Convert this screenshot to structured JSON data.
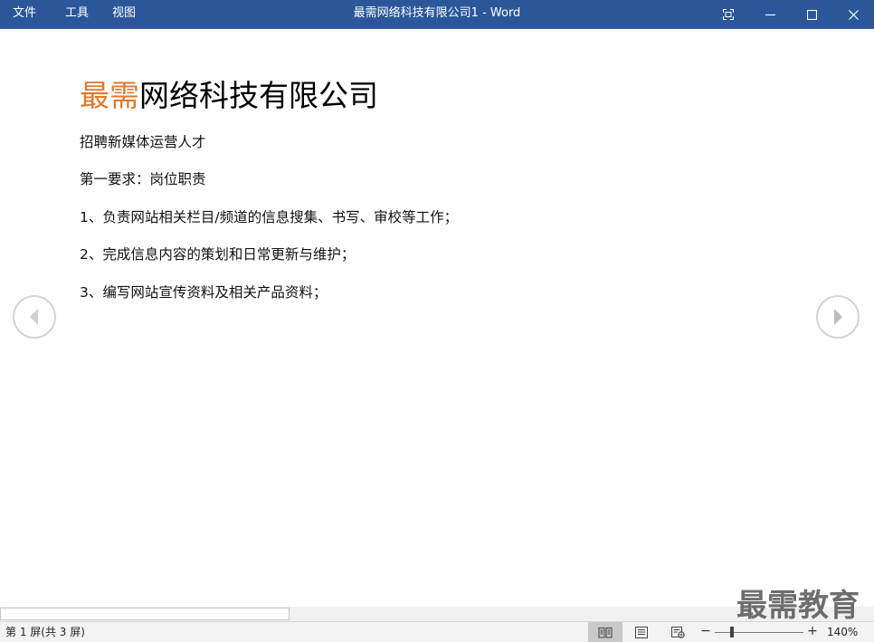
{
  "menu": {
    "file": "文件",
    "tools": "工具",
    "view": "视图"
  },
  "window": {
    "title": "最需网络科技有限公司1  -  Word",
    "title_bar_color": "#2b579a"
  },
  "document": {
    "heading_accent": "最需",
    "heading_rest": "网络科技有限公司",
    "heading_accent_color": "#e0782f",
    "paragraphs": [
      "招聘新媒体运营人才",
      "第一要求：岗位职责",
      "1、负责网站相关栏目/频道的信息搜集、书写、审校等工作；",
      "2、完成信息内容的策划和日常更新与维护；",
      "3、编写网站宣传资料及相关产品资料；"
    ]
  },
  "navigation": {
    "prev_icon": "chevron-left-icon",
    "next_icon": "chevron-right-icon"
  },
  "watermark": "最需教育",
  "status": {
    "page_info": "第 1 屏(共 3 屏)",
    "zoom_minus": "−",
    "zoom_plus": "+",
    "zoom_level": "140%",
    "views": [
      "read-mode-icon",
      "print-layout-icon",
      "web-layout-icon"
    ],
    "active_view": "read-mode-icon"
  }
}
